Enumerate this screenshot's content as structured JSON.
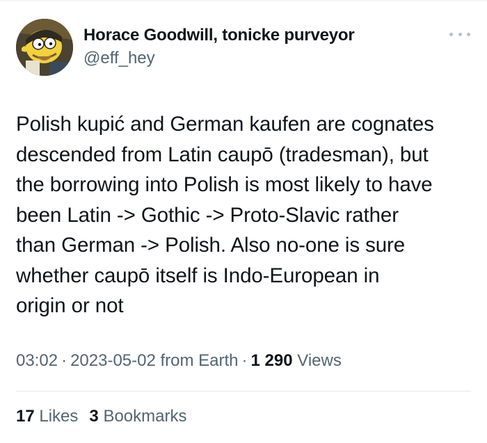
{
  "author": {
    "display_name": "Horace Goodwill, tonicke purveyor",
    "handle": "@eff_hey",
    "avatar_icon": "cartoon-avatar-icon"
  },
  "more_icon": "more-horizontal-icon",
  "tweet": {
    "text": "Polish kupić and German kaufen are cognates\ndescended from Latin caupō (tradesman), but\nthe borrowing into Polish is most likely to have\nbeen Latin -> Gothic -> Proto-Slavic rather\nthan German -> Polish. Also no-one is sure\nwhether caupō itself is Indo-European in\norigin or not"
  },
  "meta": {
    "time": "03:02",
    "separator": "·",
    "date": "2023-05-02 from Earth",
    "views_count": "1 290",
    "views_label": "Views"
  },
  "stats": {
    "likes_count": "17",
    "likes_label": "Likes",
    "bookmarks_count": "3",
    "bookmarks_label": "Bookmarks"
  },
  "colors": {
    "text_primary": "#0f1419",
    "text_secondary": "#536471",
    "divider": "#e3e6e9"
  }
}
